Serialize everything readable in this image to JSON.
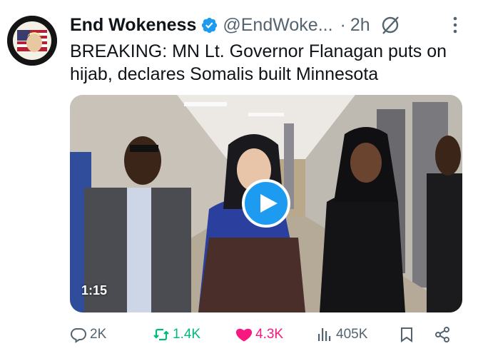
{
  "tweet": {
    "author_name": "End Wokeness",
    "handle": "@EndWoke...",
    "separator": "·",
    "time": "2h",
    "text": "BREAKING: MN Lt. Governor Flanagan puts on hijab, declares Somalis built Minnesota",
    "avatar_text_top": "I SUPPORT THE",
    "avatar_text_bottom": "FORMER TRUMPS"
  },
  "media": {
    "duration": "1:15"
  },
  "actions": {
    "replies": "2K",
    "reposts": "1.4K",
    "likes": "4.3K",
    "views": "405K"
  },
  "colors": {
    "verified": "#1d9bf0",
    "repost": "#00ba7c",
    "like": "#f91880",
    "muted": "#536471",
    "play": "#1d9bf0"
  },
  "icons": [
    "verified-badge-icon",
    "grok-icon",
    "more-options-icon",
    "play-icon",
    "reply-icon",
    "repost-icon",
    "like-icon",
    "views-icon",
    "bookmark-icon",
    "share-icon"
  ]
}
